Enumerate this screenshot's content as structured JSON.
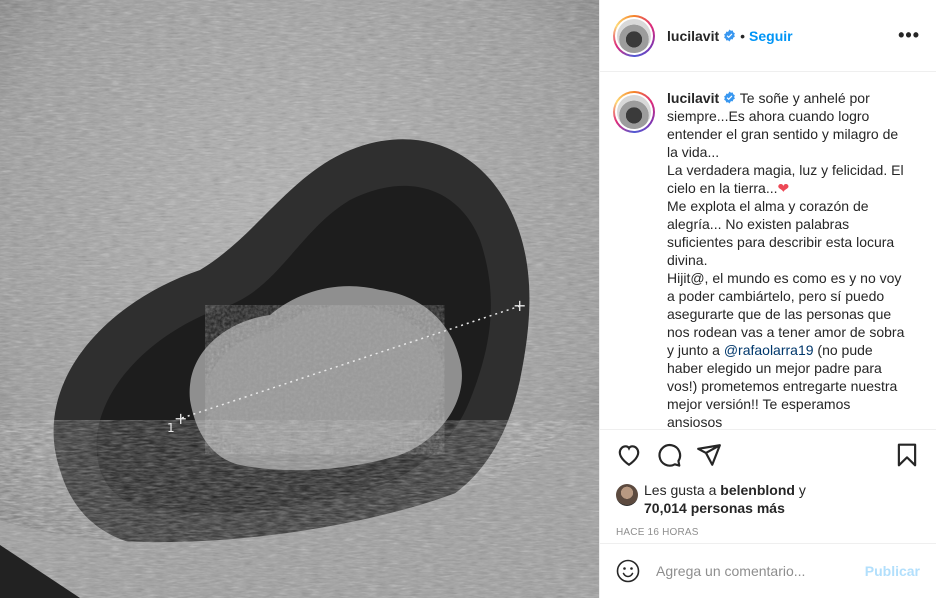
{
  "post": {
    "username": "lucilavit",
    "follow_label": "Seguir",
    "separator": "•",
    "more_label": "•••"
  },
  "caption": {
    "username": "lucilavit",
    "text_1": " Te soñe y anhelé por siempre...Es ahora cuando logro entender el gran sentido y milagro de la vida...\nLa verdadera magia, luz y felicidad. El cielo en la tierra...",
    "heart": "❤",
    "text_2": "\nMe explota el alma y corazón de alegría... No existen palabras suficientes para describir esta locura divina.\nHijit@, el mundo es como es y no voy a poder cambiártelo, pero sí puedo asegurarte que de las personas que nos rodean vas a tener amor de sobra y junto a ",
    "mention": "@rafaolarra19",
    "text_3": " (no pude haber elegido un mejor padre para vos!) prometemos entregarte nuestra mejor versión!! Te esperamos ansiosos"
  },
  "likes": {
    "prefix": "Les gusta a ",
    "liker": "belenblond",
    "mid": " y",
    "count": "70,014 personas más"
  },
  "timestamp": "HACE 16 HORAS",
  "comment": {
    "placeholder": "Agrega un comentario...",
    "publish_label": "Publicar"
  },
  "colors": {
    "accent": "#0095f6",
    "mention": "#00376b",
    "publish_disabled": "#b2dffc",
    "heart": "#ed4956"
  },
  "icons": [
    "verified-icon",
    "more-icon",
    "heart-icon",
    "comment-icon",
    "share-icon",
    "save-icon",
    "emoji-icon"
  ]
}
